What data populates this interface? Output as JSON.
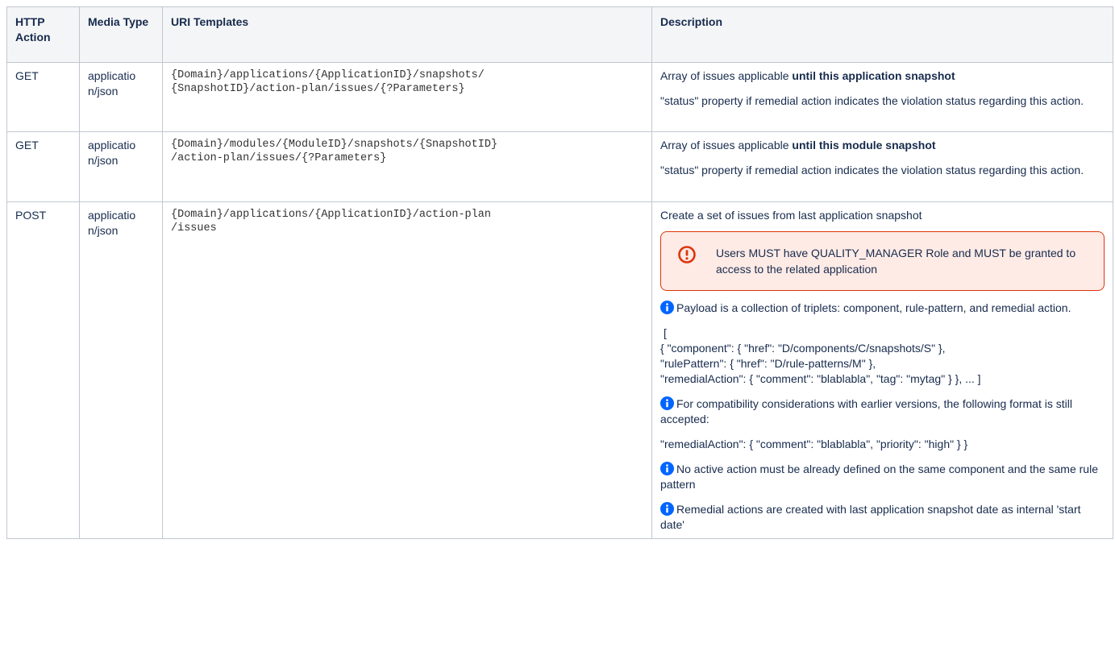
{
  "headers": {
    "action": "HTTP Action",
    "media": "Media Type",
    "uri": "URI Templates",
    "desc": "Description"
  },
  "rows": [
    {
      "action": "GET",
      "media": "applicatio n/json",
      "uri_line1": "{Domain}/applications/{ApplicationID}/snapshots/",
      "uri_line2": "{SnapshotID}/action-plan/issues/{?Parameters}",
      "desc_prefix": "Array of issues applicable ",
      "desc_bold": "until this application snapshot",
      "desc_status": "\"status\" property if remedial action indicates the violation status regarding this action."
    },
    {
      "action": "GET",
      "media": "applicatio n/json",
      "uri_line1": "{Domain}/modules/{ModuleID}/snapshots/{SnapshotID}",
      "uri_line2": "/action-plan/issues/{?Parameters}",
      "desc_prefix": "Array of issues applicable ",
      "desc_bold": "until this module snapshot",
      "desc_status": "\"status\" property if remedial action indicates the violation status regarding this action."
    },
    {
      "action": "POST",
      "media": "applicatio n/json",
      "uri_line1": "{Domain}/applications/{ApplicationID}/action-plan",
      "uri_line2": "/issues",
      "desc_intro": "Create a set of issues from last application snapshot",
      "panel_text": "Users MUST have QUALITY_MANAGER Role and MUST be granted to access to the related application",
      "info1": "Payload is a collection of triplets: component, rule-pattern, and remedial action.",
      "code_bracket": "[",
      "code_line1": "{ \"component\": { \"href\": \"D/components/C/snapshots/S\" },",
      "code_line2": "\"rulePattern\": { \"href\": \"D/rule-patterns/M\" },",
      "code_line3": "\"remedialAction\": { \"comment\": \"blablabla\", \"tag\": \"mytag\" } }, ... ]",
      "info2": "For compatibility considerations with earlier versions, the following format is still accepted:",
      "legacy_format": "\"remedialAction\": { \"comment\": \"blablabla\", \"priority\": \"high\" } }",
      "info3": "No active action must be already defined on the same component and the same rule pattern",
      "info4": "Remedial actions are created with last application snapshot date as internal 'start date'"
    }
  ],
  "colors": {
    "border": "#c1c7d0",
    "header_bg": "#f4f5f7",
    "error": "#de350b",
    "error_bg": "#ffebe6",
    "info": "#0065ff"
  },
  "icons": {
    "panel": "error-icon",
    "note": "info-icon"
  }
}
